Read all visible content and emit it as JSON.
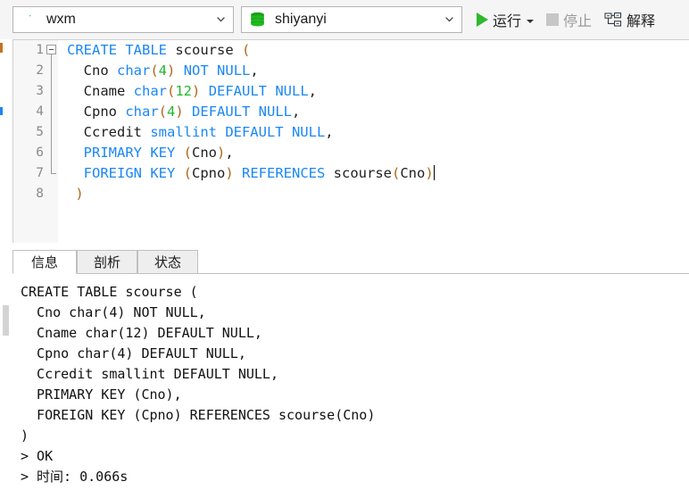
{
  "toolbar": {
    "connection": {
      "icon": "mysql-dolphin-icon",
      "value": "wxm",
      "chevron": "chevron-down-icon"
    },
    "database": {
      "icon": "database-cylinder-icon",
      "value": "shiyanyi",
      "chevron": "chevron-down-icon"
    },
    "run_label": "运行",
    "run_icon": "play-triangle-icon",
    "run_caret": "caret-down-icon",
    "stop_label": "停止",
    "stop_icon": "stop-square-icon",
    "explain_label": "解释",
    "explain_icon": "explain-tree-icon",
    "accent_green": "#2eb82e",
    "disabled_gray": "#9a9a9a"
  },
  "editor": {
    "line_numbers": [
      "1",
      "2",
      "3",
      "4",
      "5",
      "6",
      "7",
      "8"
    ],
    "lines": [
      [
        {
          "t": "CREATE TABLE ",
          "c": "kw"
        },
        {
          "t": "scourse ",
          "c": "id"
        },
        {
          "t": "(",
          "c": "par"
        }
      ],
      [
        {
          "t": "  Cno ",
          "c": "id"
        },
        {
          "t": "char",
          "c": "kw"
        },
        {
          "t": "(",
          "c": "par"
        },
        {
          "t": "4",
          "c": "num"
        },
        {
          "t": ")",
          "c": "par"
        },
        {
          "t": " ",
          "c": "id"
        },
        {
          "t": "NOT NULL",
          "c": "kw"
        },
        {
          "t": ",",
          "c": "punc"
        }
      ],
      [
        {
          "t": "  Cname ",
          "c": "id"
        },
        {
          "t": "char",
          "c": "kw"
        },
        {
          "t": "(",
          "c": "par"
        },
        {
          "t": "12",
          "c": "num"
        },
        {
          "t": ")",
          "c": "par"
        },
        {
          "t": " ",
          "c": "id"
        },
        {
          "t": "DEFAULT NULL",
          "c": "kw"
        },
        {
          "t": ",",
          "c": "punc"
        }
      ],
      [
        {
          "t": "  Cpno ",
          "c": "id"
        },
        {
          "t": "char",
          "c": "kw"
        },
        {
          "t": "(",
          "c": "par"
        },
        {
          "t": "4",
          "c": "num"
        },
        {
          "t": ")",
          "c": "par"
        },
        {
          "t": " ",
          "c": "id"
        },
        {
          "t": "DEFAULT NULL",
          "c": "kw"
        },
        {
          "t": ",",
          "c": "punc"
        }
      ],
      [
        {
          "t": "  Ccredit ",
          "c": "id"
        },
        {
          "t": "smallint DEFAULT NULL",
          "c": "kw"
        },
        {
          "t": ",",
          "c": "punc"
        }
      ],
      [
        {
          "t": "  PRIMARY KEY ",
          "c": "kw"
        },
        {
          "t": "(",
          "c": "par"
        },
        {
          "t": "Cno",
          "c": "id"
        },
        {
          "t": ")",
          "c": "par"
        },
        {
          "t": ",",
          "c": "punc"
        }
      ],
      [
        {
          "t": "  FOREIGN KEY ",
          "c": "kw"
        },
        {
          "t": "(",
          "c": "par"
        },
        {
          "t": "Cpno",
          "c": "id"
        },
        {
          "t": ")",
          "c": "par"
        },
        {
          "t": " ",
          "c": "id"
        },
        {
          "t": "REFERENCES ",
          "c": "kw"
        },
        {
          "t": "scourse",
          "c": "id"
        },
        {
          "t": "(",
          "c": "par"
        },
        {
          "t": "Cno",
          "c": "id"
        },
        {
          "t": ")",
          "c": "par"
        }
      ],
      [
        {
          "t": " ",
          "c": "id"
        },
        {
          "t": ")",
          "c": "par"
        }
      ]
    ],
    "caret_line": 6,
    "colors": {
      "keyword": "#1a87f5",
      "number": "#1fb82e",
      "paren": "#b0651a",
      "identifier": "#202020",
      "gutter_text": "#8a8a8a",
      "gutter_bg": "#f7f7f7"
    }
  },
  "results": {
    "tabs": [
      {
        "label": "信息",
        "active": true
      },
      {
        "label": "剖析",
        "active": false
      },
      {
        "label": "状态",
        "active": false
      }
    ],
    "output": "CREATE TABLE scourse (\n  Cno char(4) NOT NULL,\n  Cname char(12) DEFAULT NULL,\n  Cpno char(4) DEFAULT NULL,\n  Ccredit smallint DEFAULT NULL,\n  PRIMARY KEY (Cno),\n  FOREIGN KEY (Cpno) REFERENCES scourse(Cno)\n)\n> OK\n> 时间: 0.066s"
  }
}
